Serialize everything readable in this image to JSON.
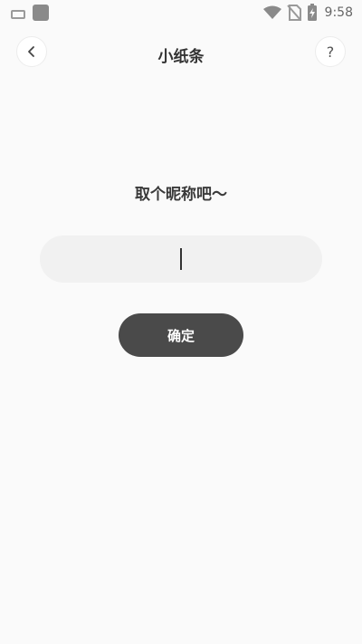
{
  "status_bar": {
    "time": "9:58",
    "icons": [
      "keyboard-icon",
      "notification-square-icon",
      "wifi-icon",
      "no-sim-icon",
      "battery-charging-icon"
    ]
  },
  "nav": {
    "title": "小纸条",
    "back_icon": "chevron-left-icon",
    "help_label": "?"
  },
  "prompt": "取个昵称吧～",
  "nickname_input": {
    "value": "",
    "placeholder": ""
  },
  "confirm_label": "确定",
  "colors": {
    "background": "#fafafa",
    "button": "#4a4a4a",
    "field": "#f1f1f1"
  }
}
